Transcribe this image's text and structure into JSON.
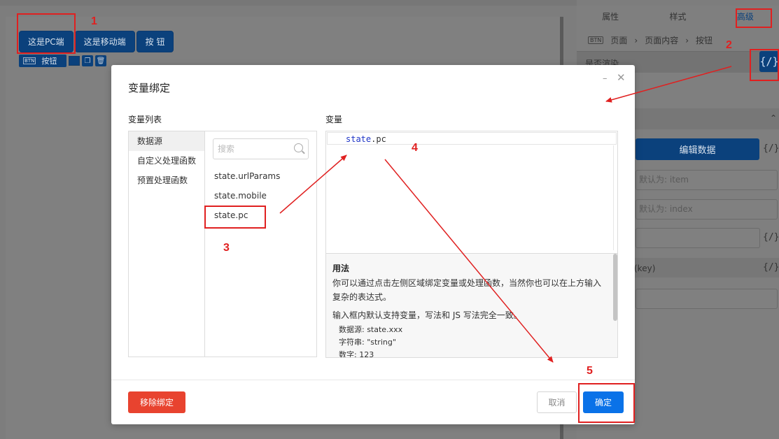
{
  "canvas": {
    "buttons": [
      "这是PC端",
      "这是移动端",
      "按 钮"
    ],
    "selected_tag": {
      "type": "BTN",
      "label": "按钮"
    }
  },
  "right_panel": {
    "tabs": [
      "属性",
      "样式",
      "高级"
    ],
    "active_tab": "高级",
    "breadcrumb": {
      "type": "BTN",
      "items": [
        "页面",
        "页面内容",
        "按钮"
      ]
    },
    "row_label": "是否渲染",
    "bind_icon": "{/}",
    "edit_data_label": "编辑数据",
    "placeholder_item": "默认为: item",
    "placeholder_index": "默认为: index",
    "key_label": "(key)"
  },
  "modal": {
    "title": "变量绑定",
    "list_label": "变量列表",
    "variable_label": "变量",
    "categories": [
      "数据源",
      "自定义处理函数",
      "预置处理函数"
    ],
    "active_category": "数据源",
    "search_placeholder": "搜索",
    "items": [
      "state.urlParams",
      "state.mobile",
      "state.pc"
    ],
    "editor": {
      "prefix": "state",
      "suffix": ".pc"
    },
    "usage": {
      "title": "用法",
      "line1": "你可以通过点击左侧区域绑定变量或处理函数，当然你也可以在上方输入",
      "line2": "复杂的表达式。",
      "line3": "输入框内默认支持变量，写法和 JS 写法完全一致。",
      "examples": [
        "数据源: state.xxx",
        "字符串: \"string\"",
        "数字: 123"
      ]
    },
    "remove_label": "移除绑定",
    "cancel_label": "取消",
    "ok_label": "确定"
  },
  "annotations": [
    "1",
    "2",
    "3",
    "4",
    "5"
  ],
  "colors": {
    "primary": "#0a72e8",
    "danger": "#e8432f",
    "annotation": "#e02020"
  }
}
